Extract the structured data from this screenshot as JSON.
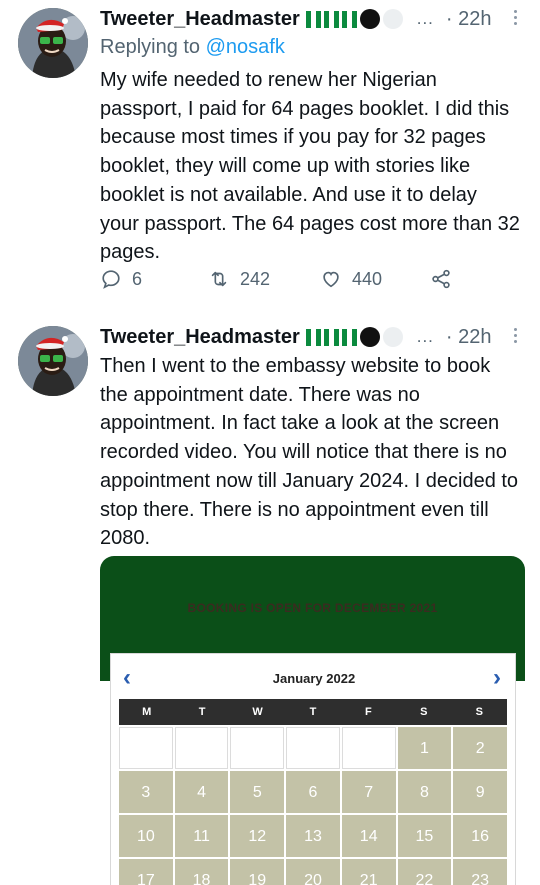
{
  "tweet1": {
    "author": "Tweeter_Headmaster",
    "time": "· 22h",
    "more": "...",
    "reply_prefix": "Replying to",
    "reply_handle": "@nosafk",
    "text": "My wife needed to renew her Nigerian passport, I paid for 64 pages booklet. I did this because most times if you pay for 32 pages booklet, they will come up with stories like booklet is not available. And use it to delay your passport. The 64 pages cost more than 32 pages.",
    "replies": "6",
    "retweets": "242",
    "likes": "440"
  },
  "tweet2": {
    "author": "Tweeter_Headmaster",
    "time": "· 22h",
    "more": "...",
    "text": "Then I went to the embassy website to book the appointment date. There was no appointment. In fact take a look at the screen recorded video. You will notice that there is no appointment now till January 2024. I decided to stop there. There is no appointment even till 2080."
  },
  "media": {
    "banner": "BOOKING IS OPEN FOR DECEMBER 2021",
    "calendar_title": "January 2022",
    "prev_icon": "‹",
    "next_icon": "›",
    "weekdays": [
      "M",
      "T",
      "W",
      "T",
      "F",
      "S",
      "S"
    ],
    "days": [
      "",
      "",
      "",
      "",
      "",
      "1",
      "2",
      "3",
      "4",
      "5",
      "6",
      "7",
      "8",
      "9",
      "10",
      "11",
      "12",
      "13",
      "14",
      "15",
      "16",
      "17",
      "18",
      "19",
      "20",
      "21",
      "22",
      "23"
    ]
  },
  "colors": {
    "link": "#1d9bf0",
    "banner": "#0b4f18",
    "available_day": "#c3c2a7",
    "nav_arrow": "#2a5db0"
  }
}
